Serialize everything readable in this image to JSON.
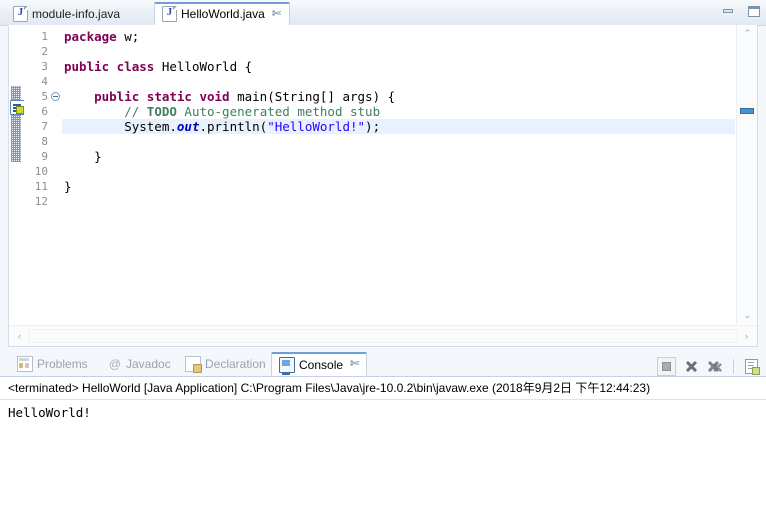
{
  "editor": {
    "tabs": [
      {
        "label": "module-info.java",
        "icon": "java-file-icon",
        "active": false,
        "closable": false
      },
      {
        "label": "HelloWorld.java",
        "icon": "java-file-icon",
        "active": true,
        "closable": true,
        "close_glyph": "✄"
      }
    ],
    "window_buttons": [
      {
        "name": "minimize-button",
        "glyph": "minimize"
      },
      {
        "name": "maximize-button",
        "glyph": "maximize"
      }
    ],
    "line_numbers": [
      "1",
      "2",
      "3",
      "4",
      "5",
      "6",
      "7",
      "8",
      "9",
      "10",
      "11",
      "12"
    ],
    "folding": {
      "line": 5,
      "state": "collapsible-minus"
    },
    "highlighted_line": 7,
    "scroll": {
      "up_arrow": "⌃",
      "down_arrow": "⌄",
      "left_arrow": "‹",
      "right_arrow": "›"
    },
    "code_lines": [
      {
        "n": 1,
        "segments": [
          {
            "t": "package ",
            "c": "kw"
          },
          {
            "t": "w;",
            "c": ""
          }
        ]
      },
      {
        "n": 2,
        "segments": []
      },
      {
        "n": 3,
        "segments": [
          {
            "t": "public class ",
            "c": "kw"
          },
          {
            "t": "HelloWorld {",
            "c": ""
          }
        ]
      },
      {
        "n": 4,
        "segments": []
      },
      {
        "n": 5,
        "segments": [
          {
            "t": "    ",
            "c": ""
          },
          {
            "t": "public static void ",
            "c": "kw"
          },
          {
            "t": "main(String[] args) {",
            "c": ""
          }
        ]
      },
      {
        "n": 6,
        "segments": [
          {
            "t": "        // ",
            "c": "cmt"
          },
          {
            "t": "TODO",
            "c": "todo"
          },
          {
            "t": " Auto-generated method stub",
            "c": "cmt"
          }
        ]
      },
      {
        "n": 7,
        "segments": [
          {
            "t": "        System.",
            "c": ""
          },
          {
            "t": "out",
            "c": "stat"
          },
          {
            "t": ".println(",
            "c": ""
          },
          {
            "t": "\"HelloWorld!\"",
            "c": "str"
          },
          {
            "t": ");",
            "c": ""
          }
        ]
      },
      {
        "n": 8,
        "segments": []
      },
      {
        "n": 9,
        "segments": [
          {
            "t": "    }",
            "c": ""
          }
        ]
      },
      {
        "n": 10,
        "segments": []
      },
      {
        "n": 11,
        "segments": [
          {
            "t": "}",
            "c": ""
          }
        ]
      },
      {
        "n": 12,
        "segments": []
      }
    ]
  },
  "console_part": {
    "tabs": [
      {
        "label": "Problems",
        "icon": "problems-icon",
        "active": false,
        "closable": false
      },
      {
        "label": "Javadoc",
        "icon": "javadoc-icon",
        "active": false,
        "closable": false,
        "icon_glyph": "@"
      },
      {
        "label": "Declaration",
        "icon": "declaration-icon",
        "active": false,
        "closable": false
      },
      {
        "label": "Console",
        "icon": "console-icon",
        "active": true,
        "closable": true,
        "close_glyph": "✄"
      }
    ],
    "toolbar": [
      {
        "name": "terminate-button",
        "icon": "stop-square-icon",
        "enabled": false
      },
      {
        "name": "remove-launch-button",
        "icon": "remove-x-icon",
        "enabled": false
      },
      {
        "name": "remove-all-launches-button",
        "icon": "remove-all-xx-icon",
        "enabled": false
      },
      {
        "name": "open-console-button",
        "icon": "open-console-doc-icon",
        "enabled": true
      }
    ],
    "launch_header": "<terminated> HelloWorld [Java Application] C:\\Program Files\\Java\\jre-10.0.2\\bin\\javaw.exe (2018年9月2日 下午12:44:23)",
    "output": "HelloWorld!"
  },
  "colors": {
    "keyword": "#7f0055",
    "comment": "#3f7f5f",
    "string": "#2a00ff",
    "static_field": "#0000c0",
    "line_highlight": "#e8f2fe",
    "tab_accent": "#6c9fd8",
    "change_bar": "#4a90d9"
  }
}
